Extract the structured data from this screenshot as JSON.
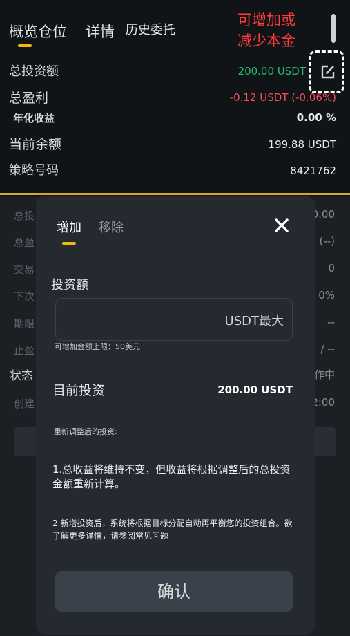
{
  "tabs": {
    "overview": "概览仓位",
    "detail": "详情",
    "history": "历史委托"
  },
  "annotation": {
    "line1": "可增加或",
    "line2": "减少本金"
  },
  "summary": {
    "total_investment": {
      "label": "总投资额",
      "value": "200.00  USDT"
    },
    "total_profit": {
      "label": "总盈利",
      "value": "-0.12  USDT  (-0.06%)"
    },
    "annual_yield": {
      "label": "年化收益",
      "value": "0.00  %"
    },
    "current_balance": {
      "label": "当前余额",
      "value": "199.88  USDT"
    },
    "strategy_id": {
      "label": "策略号码",
      "value": "8421762"
    }
  },
  "background": {
    "left_labels": [
      "总投",
      "总盈",
      "交易",
      "下次",
      "期限",
      "止盈",
      "状态",
      "创建"
    ],
    "right_values": [
      "0.00",
      "(--)",
      "0",
      "0%",
      "--",
      "/ --",
      "作中",
      "2:00"
    ]
  },
  "modal": {
    "tab_add": "增加",
    "tab_remove": "移除",
    "investment_label": "投资额",
    "input_value": "",
    "input_suffix": "USDT最大",
    "hint": "可增加金额上限：50美元",
    "current_label": "目前投资",
    "current_value": "200.00 USDT",
    "adjusted_label": "重新调整后的投资:",
    "note1": "1.总收益将维持不变，但收益将根据调整后的总投资金额重新计算。",
    "note2": "2.新增投资后，系统将根据目标分配自动再平衡您的投资组合。欲了解更多详情，请参阅常见问题",
    "confirm": "确认"
  },
  "colors": {
    "accent": "#f0b90b",
    "profit_positive": "#1fbf75",
    "profit_negative": "#f04e5e",
    "annotation": "#ff3b3b"
  }
}
